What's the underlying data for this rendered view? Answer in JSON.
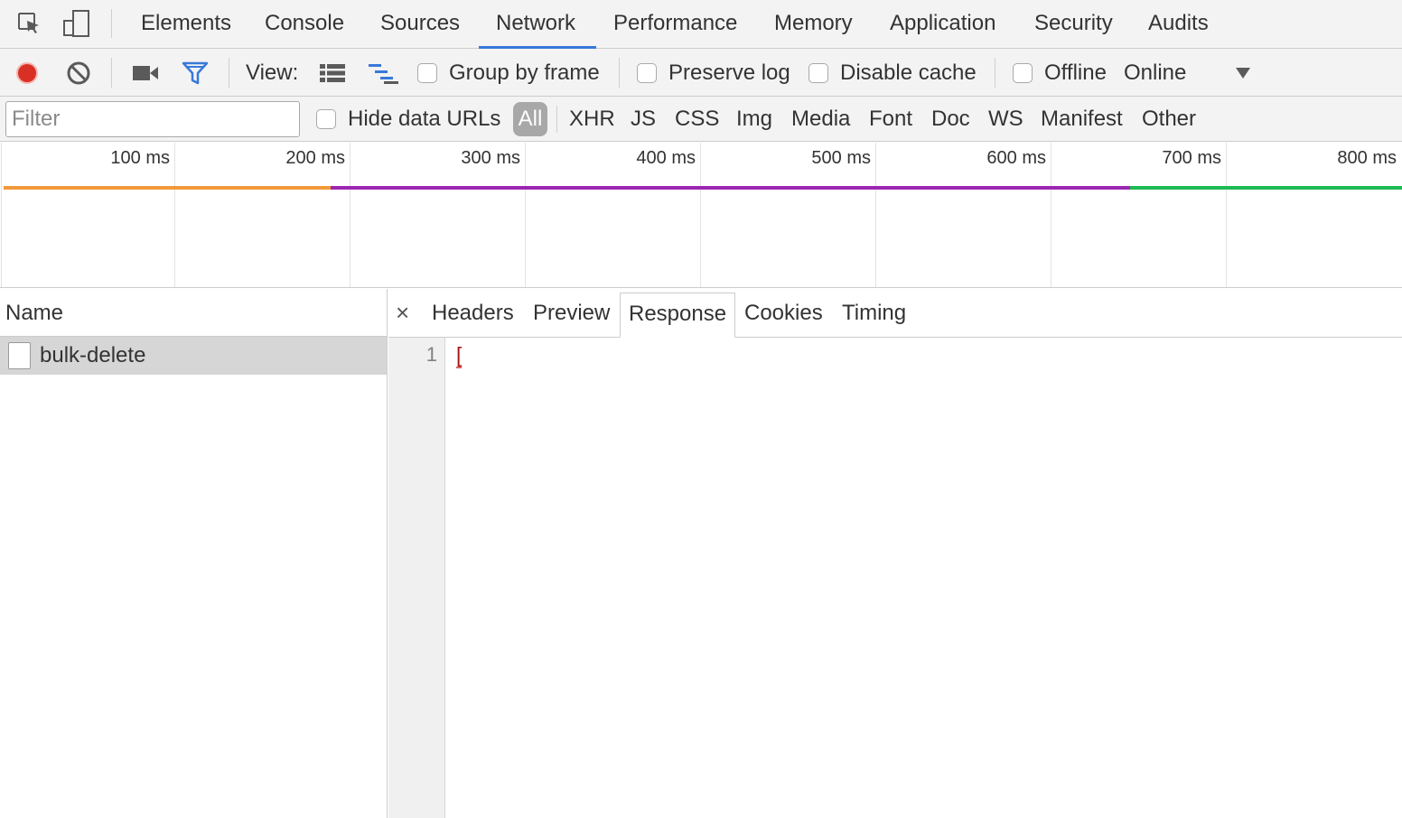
{
  "tabs": [
    "Elements",
    "Console",
    "Sources",
    "Network",
    "Performance",
    "Memory",
    "Application",
    "Security",
    "Audits"
  ],
  "active_tab": "Network",
  "toolbar": {
    "view_label": "View:",
    "group_by_frame": "Group by frame",
    "preserve_log": "Preserve log",
    "disable_cache": "Disable cache",
    "offline": "Offline",
    "throttle_value": "Online"
  },
  "filter": {
    "placeholder": "Filter",
    "hide_data_urls": "Hide data URLs",
    "types": [
      "All",
      "XHR",
      "JS",
      "CSS",
      "Img",
      "Media",
      "Font",
      "Doc",
      "WS",
      "Manifest",
      "Other"
    ],
    "active_type": "All"
  },
  "overview": {
    "ticks": [
      "100 ms",
      "200 ms",
      "300 ms",
      "400 ms",
      "500 ms",
      "600 ms",
      "700 ms",
      "800 ms"
    ],
    "colors": {
      "waiting": "#f29a3a",
      "download": "#9c27b0",
      "finish": "#1db954"
    }
  },
  "requests": {
    "header": "Name",
    "items": [
      "bulk-delete"
    ]
  },
  "details": {
    "close": "×",
    "tabs": [
      "Headers",
      "Preview",
      "Response",
      "Cookies",
      "Timing"
    ],
    "active_tab": "Response",
    "line_number": "1",
    "code": "["
  },
  "colors": {
    "record": "#d93025",
    "accent": "#3879d9",
    "selected_row": "#d6d6d6"
  }
}
